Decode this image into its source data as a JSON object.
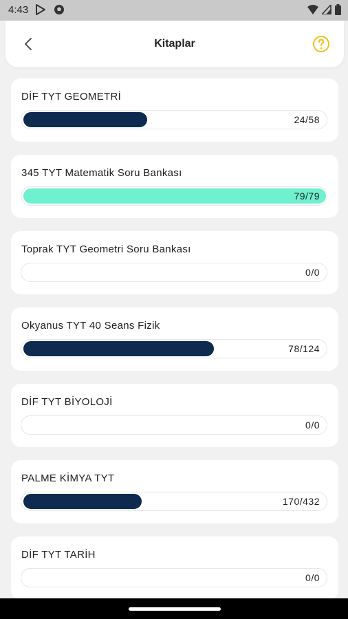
{
  "status_bar": {
    "time": "4:43",
    "left_icons": [
      "play-store-icon",
      "soccer-ball-icon"
    ],
    "right_icons": [
      "wifi-icon",
      "signal-icon",
      "battery-icon"
    ]
  },
  "header": {
    "title": "Kitaplar",
    "back_icon": "chevron-left-icon",
    "help_icon": "question-circle-icon",
    "help_color": "#f3c018"
  },
  "books": [
    {
      "name": "DİF TYT GEOMETRİ",
      "count": "24/58",
      "progress": 0.41,
      "bar_color": "#0e2a4f"
    },
    {
      "name": "345 TYT Matematik Soru Bankası",
      "count": "79/79",
      "progress": 1.0,
      "bar_color": "#6ff0cf"
    },
    {
      "name": "Toprak TYT Geometri Soru Bankası",
      "count": "0/0",
      "progress": 0,
      "bar_color": "#0e2a4f"
    },
    {
      "name": "Okyanus TYT 40 Seans Fizik",
      "count": "78/124",
      "progress": 0.63,
      "bar_color": "#0e2a4f"
    },
    {
      "name": "DİF TYT BİYOLOJİ",
      "count": "0/0",
      "progress": 0,
      "bar_color": "#0e2a4f"
    },
    {
      "name": "PALME KİMYA TYT",
      "count": "170/432",
      "progress": 0.39,
      "bar_color": "#0e2a4f"
    },
    {
      "name": "DİF TYT TARİH",
      "count": "0/0",
      "progress": 0,
      "bar_color": "#0e2a4f"
    }
  ]
}
